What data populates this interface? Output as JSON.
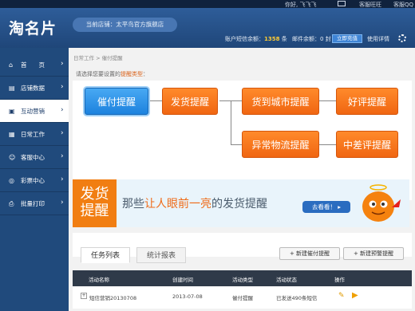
{
  "topbar": {
    "user": "你好, 飞飞飞",
    "mail_icon": "mail-icon",
    "service_wang": "客服旺旺",
    "service_qq": "客服QQ"
  },
  "header": {
    "logo": "淘名片",
    "store": "当前店铺：太平鸟官方旗舰店",
    "balance_label": "账户短信余额：",
    "balance_value": "1358",
    "balance_unit": "条",
    "mail_label": "邮件余额：",
    "mail_value": "0",
    "mail_unit": "封",
    "recharge": "立即充值",
    "guide": "使用详情"
  },
  "sidebar": {
    "items": [
      {
        "icon": "home-icon",
        "label": "首　　页"
      },
      {
        "icon": "chart-icon",
        "label": "店铺数据"
      },
      {
        "icon": "marketing-icon",
        "label": "互动营销"
      },
      {
        "icon": "work-icon",
        "label": "日常工作"
      },
      {
        "icon": "customer-icon",
        "label": "客服中心"
      },
      {
        "icon": "lottery-icon",
        "label": "彩票中心"
      },
      {
        "icon": "print-icon",
        "label": "批量打印"
      }
    ]
  },
  "main": {
    "breadcrumb": "日常工作 > 催付提醒",
    "prompt_pre": "请选择您要设置的",
    "prompt_hl": "提醒类型",
    "prompt_post": "：",
    "reminders": {
      "payment": "催付提醒",
      "shipping": "发货提醒",
      "city": "货到城市提醒",
      "review": "好评提醒",
      "logistics": "异常物流提醒",
      "bad_review": "中差评提醒"
    },
    "banner": {
      "left": "发货\n提醒",
      "msg_pre": "那些",
      "msg_hl": "让人眼前一亮",
      "msg_post": "的发货提醒",
      "go": "去看看！"
    },
    "tabs": [
      "任务列表",
      "统计报表"
    ],
    "actions": [
      "+ 新建催付提醒",
      "+ 新建预警提醒"
    ],
    "table": {
      "headers": [
        "活动名称",
        "创建时间",
        "活动类型",
        "活动状态",
        "操作"
      ],
      "rows": [
        {
          "name": "短信营销20130708",
          "date": "2013-07-08",
          "type": "催付提醒",
          "status": "已发送490条短信"
        }
      ]
    }
  }
}
